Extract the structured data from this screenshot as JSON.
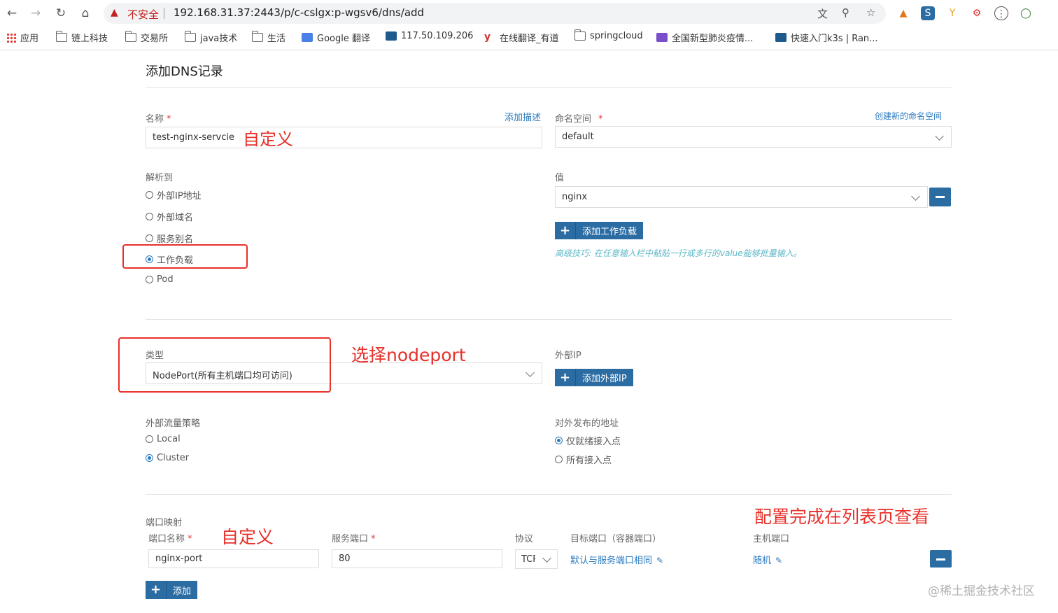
{
  "browser": {
    "insecure_label": "不安全",
    "url": "192.168.31.37:2443/p/c-cslgx:p-wgsv6/dns/add",
    "bookmarks": [
      "应用",
      "链上科技",
      "交易所",
      "java技术",
      "生活",
      "Google 翻译",
      "117.50.109.206",
      "在线翻译_有道",
      "springcloud",
      "全国新型肺炎疫情...",
      "快速入门k3s | Ran..."
    ]
  },
  "page": {
    "title": "添加DNS记录",
    "name_label": "名称",
    "add_description": "添加描述",
    "name_value": "test-nginx-servcie",
    "namespace_label": "命名空间",
    "create_namespace": "创建新的命名空间",
    "namespace_value": "default",
    "resolve_label": "解析到",
    "resolve_options": [
      "外部IP地址",
      "外部域名",
      "服务别名",
      "工作负载",
      "Pod"
    ],
    "resolve_selected": "工作负载",
    "value_label": "值",
    "value_selected": "nginx",
    "add_workload": "添加工作负载",
    "tip": "高级技巧: 在任意输入栏中粘贴一行或多行的value能够批量输入。",
    "type_label": "类型",
    "type_value": "NodePort(所有主机端口均可访问)",
    "external_ip_label": "外部IP",
    "add_external_ip": "添加外部IP",
    "traffic_policy_label": "外部流量策略",
    "traffic_options": [
      "Local",
      "Cluster"
    ],
    "traffic_selected": "Cluster",
    "publish_label": "对外发布的地址",
    "publish_options": [
      "仅就绪接入点",
      "所有接入点"
    ],
    "publish_selected": "仅就绪接入点",
    "port_mapping_label": "端口映射",
    "port_name_label": "端口名称",
    "service_port_label": "服务端口",
    "protocol_label": "协议",
    "target_port_label": "目标端口（容器端口）",
    "host_port_label": "主机端口",
    "port_name_value": "nginx-port",
    "service_port_value": "80",
    "protocol_value": "TCP",
    "target_port_value": "默认与服务端口相同",
    "host_port_value": "随机",
    "add_button": "添加"
  },
  "annotations": {
    "custom_1": "自定义",
    "select_nodeport": "选择nodeport",
    "custom_2": "自定义",
    "view_list": "配置完成在列表页查看"
  },
  "watermark": "@稀土掘金技术社区"
}
